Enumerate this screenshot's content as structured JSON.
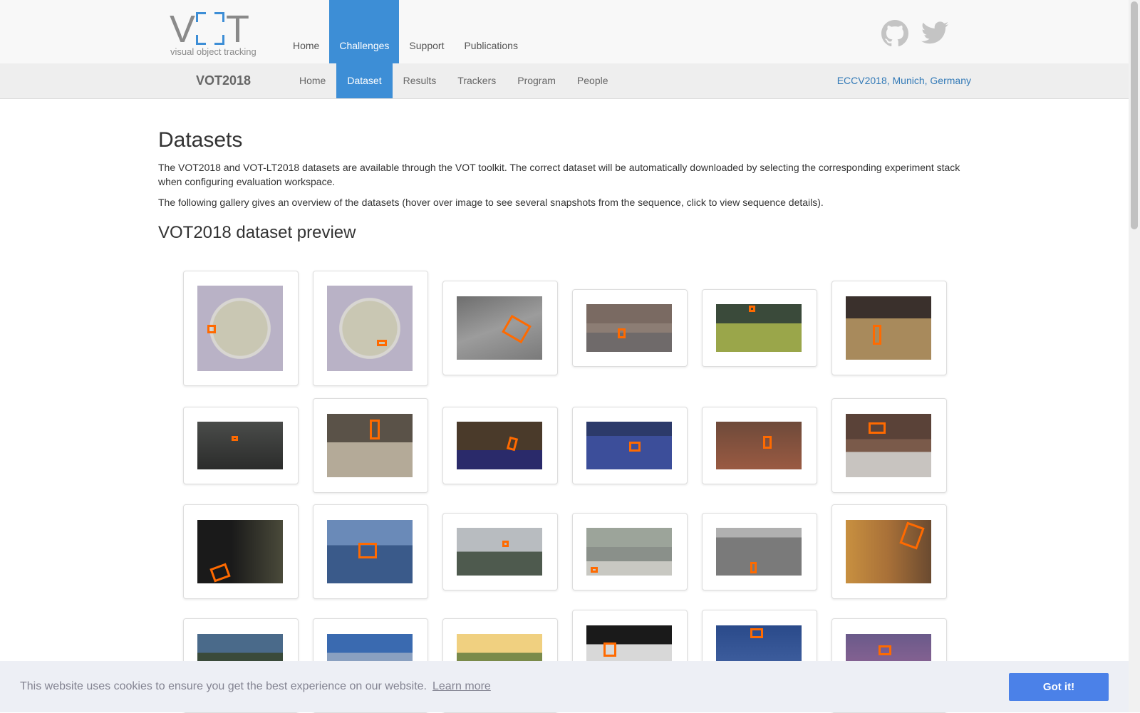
{
  "brand": {
    "logo_text": "VOT",
    "logo_tagline": "visual object tracking"
  },
  "main_nav": [
    {
      "label": "Home",
      "active": false
    },
    {
      "label": "Challenges",
      "active": true
    },
    {
      "label": "Support",
      "active": false
    },
    {
      "label": "Publications",
      "active": false
    }
  ],
  "social_icons": [
    "github-icon",
    "twitter-icon"
  ],
  "sub_nav": {
    "brand": "VOT2018",
    "items": [
      {
        "label": "Home",
        "active": false
      },
      {
        "label": "Dataset",
        "active": true
      },
      {
        "label": "Results",
        "active": false
      },
      {
        "label": "Trackers",
        "active": false
      },
      {
        "label": "Program",
        "active": false
      },
      {
        "label": "People",
        "active": false
      }
    ],
    "venue": "ECCV2018, Munich, Germany"
  },
  "content": {
    "title": "Datasets",
    "paragraph1": "The VOT2018 and VOT-LT2018 datasets are available through the VOT toolkit. The correct dataset will be automatically downloaded by selecting the corresponding experiment stack when configuring evaluation workspace.",
    "paragraph2": "The following gallery gives an overview of the datasets (hover over image to see several snapshots from the sequence, click to view sequence details).",
    "preview_title": "VOT2018 dataset preview"
  },
  "cookie_banner": {
    "message": "This website uses cookies to ensure you get the best experience on our website.",
    "learn_more": "Learn more",
    "accept": "Got it!"
  },
  "colors": {
    "accent": "#3d8ed6",
    "box": "#ff6a00",
    "cookie_button": "#4b81e8"
  }
}
